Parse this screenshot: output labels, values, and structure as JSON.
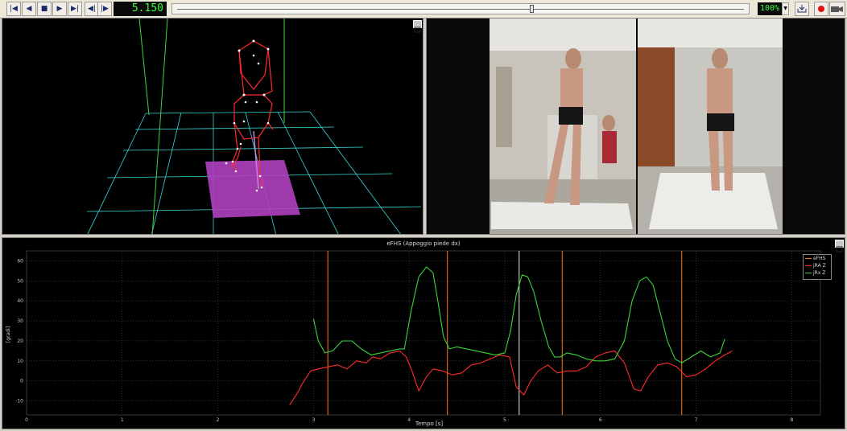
{
  "toolbar": {
    "timecode": "5.150",
    "zoom": "100%",
    "buttons": [
      "go-to-start",
      "step-back",
      "stop",
      "play",
      "go-to-end",
      "previous-event",
      "next-event"
    ]
  },
  "colors": {
    "grid3d": "#3ad6d6",
    "skeleton": "#ff2a2a",
    "force_plate": "#b040c0",
    "series_efhs": "#ff7a1a",
    "series_jra": "#ff2a2a",
    "series_jrx": "#3cd43c"
  },
  "graph": {
    "title": "eFHS (Appoggio piede dx)",
    "xlabel": "Tempo [s]",
    "ylabel": "[gradi]"
  },
  "chart_data": {
    "type": "line",
    "title": "eFHS (Appoggio piede dx)",
    "xlabel": "Tempo [s]",
    "ylabel": "[gradi]",
    "xlim": [
      0,
      8.3
    ],
    "ylim": [
      -17,
      65
    ],
    "xticks": [
      0,
      1,
      2,
      3,
      4,
      5,
      6,
      7,
      8
    ],
    "yticks": [
      -10,
      0,
      10,
      20,
      30,
      40,
      50,
      60
    ],
    "grid": true,
    "legend": "top-right",
    "event_lines": [
      3.15,
      4.4,
      5.6,
      6.85
    ],
    "cursor": 5.15,
    "series": [
      {
        "name": "eFHS",
        "x": [],
        "y": []
      },
      {
        "name": "jRA Z",
        "x": [
          2.75,
          2.82,
          2.9,
          2.97,
          3.05,
          3.15,
          3.25,
          3.35,
          3.45,
          3.55,
          3.62,
          3.7,
          3.8,
          3.9,
          3.97,
          4.03,
          4.1,
          4.18,
          4.25,
          4.35,
          4.45,
          4.55,
          4.65,
          4.75,
          4.85,
          4.95,
          5.05,
          5.12,
          5.2,
          5.27,
          5.35,
          5.45,
          5.55,
          5.65,
          5.75,
          5.85,
          5.95,
          6.05,
          6.15,
          6.25,
          6.35,
          6.42,
          6.5,
          6.6,
          6.7,
          6.8,
          6.9,
          7.0,
          7.1,
          7.2,
          7.3,
          7.38
        ],
        "y": [
          -12,
          -7,
          0,
          5,
          6,
          7,
          8,
          6,
          10,
          9,
          12,
          11,
          14,
          15,
          12,
          5,
          -5,
          2,
          6,
          5,
          3,
          4,
          8,
          9,
          11,
          13,
          12,
          -3,
          -7,
          0,
          5,
          8,
          4,
          5,
          5,
          7,
          12,
          14,
          15,
          9,
          -4,
          -5,
          2,
          8,
          9,
          7,
          2,
          3,
          6,
          10,
          13,
          15
        ]
      },
      {
        "name": "jRx Z",
        "x": [
          3.0,
          3.05,
          3.12,
          3.2,
          3.3,
          3.4,
          3.5,
          3.6,
          3.7,
          3.8,
          3.9,
          3.95,
          4.02,
          4.1,
          4.18,
          4.25,
          4.3,
          4.36,
          4.42,
          4.5,
          4.6,
          4.7,
          4.8,
          4.9,
          5.0,
          5.06,
          5.12,
          5.18,
          5.24,
          5.3,
          5.38,
          5.46,
          5.52,
          5.58,
          5.65,
          5.75,
          5.85,
          5.95,
          6.05,
          6.15,
          6.25,
          6.33,
          6.41,
          6.48,
          6.55,
          6.62,
          6.7,
          6.78,
          6.85,
          6.95,
          7.05,
          7.15,
          7.25,
          7.3
        ],
        "y": [
          31,
          20,
          14,
          15,
          20,
          20,
          16,
          13,
          14,
          15,
          16,
          16,
          35,
          52,
          57,
          54,
          40,
          22,
          16,
          17,
          16,
          15,
          14,
          13,
          14,
          25,
          43,
          53,
          52,
          45,
          30,
          17,
          12,
          12,
          14,
          13,
          11,
          10,
          10,
          11,
          20,
          40,
          50,
          52,
          48,
          35,
          20,
          11,
          9,
          12,
          15,
          12,
          14,
          21
        ]
      }
    ]
  }
}
